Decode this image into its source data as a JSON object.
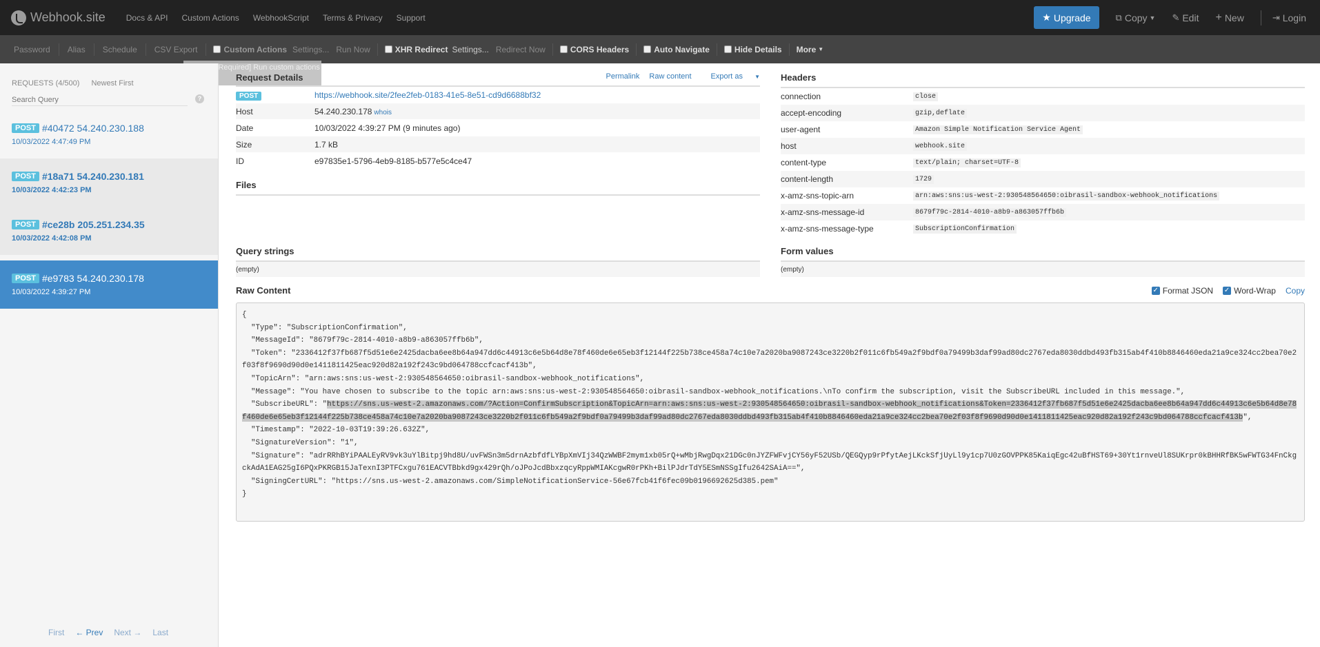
{
  "navbar": {
    "brand": "Webhook.site",
    "links": [
      "Docs & API",
      "Custom Actions",
      "WebhookScript",
      "Terms & Privacy",
      "Support"
    ],
    "upgrade": "Upgrade",
    "copy": "Copy",
    "edit": "Edit",
    "new": "New",
    "login": "Login"
  },
  "toolbar": {
    "password": "Password",
    "alias": "Alias",
    "schedule": "Schedule",
    "csv_export": "CSV Export",
    "custom_actions": "Custom Actions",
    "custom_settings": "Settings...",
    "run_now": "Run Now",
    "xhr_redirect": "XHR Redirect",
    "xhr_settings": "Settings...",
    "redirect_now": "Redirect Now",
    "cors_headers": "CORS Headers",
    "auto_navigate": "Auto Navigate",
    "hide_details": "Hide Details",
    "more": "More",
    "tooltip": "[Upgrade Required] Run custom actions"
  },
  "sidebar": {
    "requests_count": "REQUESTS (4/500)",
    "newest_first": "Newest First",
    "search_placeholder": "Search Query",
    "requests": [
      {
        "method": "POST",
        "label": "#40472 54.240.230.188",
        "time": "10/03/2022 4:47:49 PM"
      },
      {
        "method": "POST",
        "label": "#18a71 54.240.230.181",
        "time": "10/03/2022 4:42:23 PM"
      },
      {
        "method": "POST",
        "label": "#ce28b 205.251.234.35",
        "time": "10/03/2022 4:42:08 PM"
      },
      {
        "method": "POST",
        "label": "#e9783 54.240.230.178",
        "time": "10/03/2022 4:39:27 PM"
      }
    ],
    "pager": {
      "first": "First",
      "prev": "← Prev",
      "next": "Next →",
      "last": "Last"
    }
  },
  "request_details": {
    "title": "Request Details",
    "permalink": "Permalink",
    "raw_content": "Raw content",
    "export_as": "Export as",
    "method": "POST",
    "url": "https://webhook.site/2fee2feb-0183-41e5-8e51-cd9d6688bf32",
    "host_label": "Host",
    "host": "54.240.230.178",
    "whois": "whois",
    "date_label": "Date",
    "date": "10/03/2022 4:39:27 PM (9 minutes ago)",
    "size_label": "Size",
    "size": "1.7 kB",
    "id_label": "ID",
    "id": "e97835e1-5796-4eb9-8185-b577e5c4ce47"
  },
  "files": {
    "title": "Files"
  },
  "query_strings": {
    "title": "Query strings",
    "empty": "(empty)"
  },
  "form_values": {
    "title": "Form values",
    "empty": "(empty)"
  },
  "headers": {
    "title": "Headers",
    "rows": [
      {
        "k": "connection",
        "v": "close"
      },
      {
        "k": "accept-encoding",
        "v": "gzip,deflate"
      },
      {
        "k": "user-agent",
        "v": "Amazon Simple Notification Service Agent"
      },
      {
        "k": "host",
        "v": "webhook.site"
      },
      {
        "k": "content-type",
        "v": "text/plain; charset=UTF-8"
      },
      {
        "k": "content-length",
        "v": "1729"
      },
      {
        "k": "x-amz-sns-topic-arn",
        "v": "arn:aws:sns:us-west-2:930548564650:oibrasil-sandbox-webhook_notifications"
      },
      {
        "k": "x-amz-sns-message-id",
        "v": "8679f79c-2814-4010-a8b9-a863057ffb6b"
      },
      {
        "k": "x-amz-sns-message-type",
        "v": "SubscriptionConfirmation"
      }
    ]
  },
  "raw": {
    "title": "Raw Content",
    "format_json": "Format JSON",
    "word_wrap": "Word-Wrap",
    "copy": "Copy",
    "body_before": "{\n  \"Type\": \"SubscriptionConfirmation\",\n  \"MessageId\": \"8679f79c-2814-4010-a8b9-a863057ffb6b\",\n  \"Token\": \"2336412f37fb687f5d51e6e2425dacba6ee8b64a947dd6c44913c6e5b64d8e78f460de6e65eb3f12144f225b738ce458a74c10e7a2020ba9087243ce3220b2f011c6fb549a2f9bdf0a79499b3daf99ad80dc2767eda8030ddbd493fb315ab4f410b8846460eda21a9ce324cc2bea70e2f03f8f9690d90d0e1411811425eac920d82a192f243c9bd064788ccfcacf413b\",\n  \"TopicArn\": \"arn:aws:sns:us-west-2:930548564650:oibrasil-sandbox-webhook_notifications\",\n  \"Message\": \"You have chosen to subscribe to the topic arn:aws:sns:us-west-2:930548564650:oibrasil-sandbox-webhook_notifications.\\nTo confirm the subscription, visit the SubscribeURL included in this message.\",\n  \"SubscribeURL\": \"",
    "body_highlight": "https://sns.us-west-2.amazonaws.com/?Action=ConfirmSubscription&TopicArn=arn:aws:sns:us-west-2:930548564650:oibrasil-sandbox-webhook_notifications&Token=2336412f37fb687f5d51e6e2425dacba6ee8b64a947dd6c44913c6e5b64d8e78f460de6e65eb3f12144f225b738ce458a74c10e7a2020ba9087243ce3220b2f011c6fb549a2f9bdf0a79499b3daf99ad80dc2767eda8030ddbd493fb315ab4f410b8846460eda21a9ce324cc2bea70e2f03f8f9690d90d0e1411811425eac920d82a192f243c9bd064788ccfcacf413b",
    "body_after": "\",\n  \"Timestamp\": \"2022-10-03T19:39:26.632Z\",\n  \"SignatureVersion\": \"1\",\n  \"Signature\": \"adrRRhBYiPAALEyRV9vk3uYlBitpj9hd8U/uvFWSn3m5drnAzbfdfLYBpXmVIj34QzWWBF2mym1xb05rQ+wMbjRwgDqx21DGc0nJYZFWFvjCY56yF52USb/QEGQyp9rPfytAejLKckSfjUyLl9y1cp7U0zGOVPPK85KaiqEgc42uBfHST69+30Yt1rnveUl8SUKrpr0kBHHRfBK5wFWTG34FnCkgckAdA1EAG25gI6PQxPKRGB15JaTexnI3PTFCxgu761EACVTBbkd9gx429rQh/oJPoJcdBbxzqcyRppWMIAKcgwR0rPKh+BilPJdrTdY5ESmNSSgIfu2642SAiA==\",\n  \"SigningCertURL\": \"https://sns.us-west-2.amazonaws.com/SimpleNotificationService-56e67fcb41f6fec09b0196692625d385.pem\"\n}"
  }
}
